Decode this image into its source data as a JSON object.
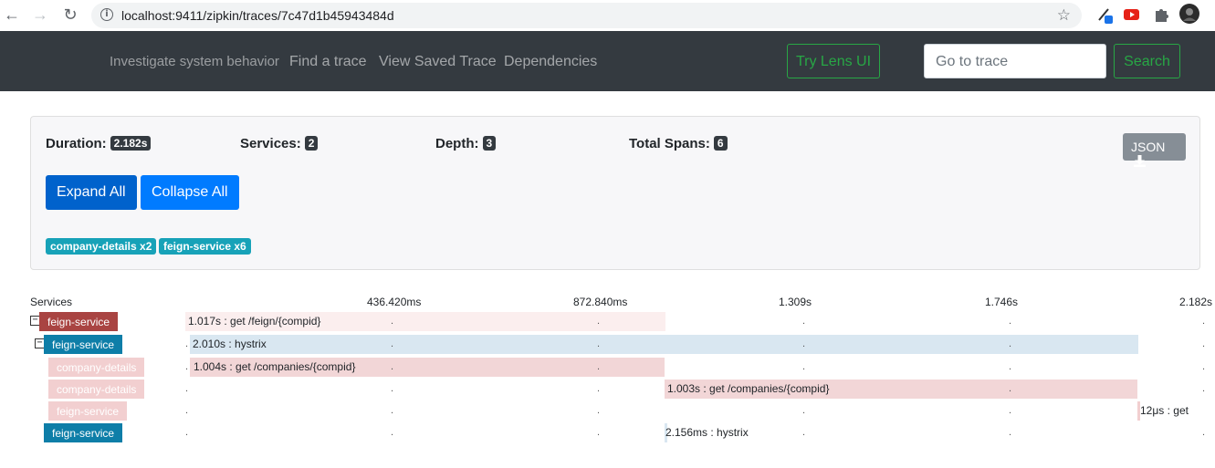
{
  "browser": {
    "url": "localhost:9411/zipkin/traces/7c47d1b45943484d",
    "back_icon": "arrow-left-icon",
    "forward_icon": "arrow-right-icon",
    "reload_icon": "reload-icon"
  },
  "navbar": {
    "tagline": "Investigate system behavior",
    "links": [
      "Find a trace",
      "View Saved Trace",
      "Dependencies"
    ],
    "try_lens": "Try Lens UI",
    "goto_placeholder": "Go to trace",
    "search": "Search",
    "accent": "#28a745"
  },
  "summary": {
    "duration_label": "Duration:",
    "duration": "2.182s",
    "services_label": "Services:",
    "services": "2",
    "depth_label": "Depth:",
    "depth": "3",
    "spans_label": "Total Spans:",
    "spans": "6",
    "json_button": "JSON",
    "expand_all": "Expand All",
    "collapse_all": "Collapse All",
    "service_badges": [
      "company-details x2",
      "feign-service x6"
    ]
  },
  "timeline": {
    "services_header": "Services",
    "ticks": [
      "436.420ms",
      "872.840ms",
      "1.309s",
      "1.746s",
      "2.182s"
    ],
    "rows": [
      {
        "service": "feign-service",
        "label": "1.017s : get /feign/{compid}"
      },
      {
        "service": "feign-service",
        "label": "2.010s : hystrix"
      },
      {
        "service": "company-details",
        "label": "1.004s : get /companies/{compid}"
      },
      {
        "service": "company-details",
        "label": "1.003s : get /companies/{compid}"
      },
      {
        "service": "feign-service",
        "label": "12μs : get"
      },
      {
        "service": "feign-service",
        "label": "2.156ms : hystrix"
      }
    ]
  }
}
